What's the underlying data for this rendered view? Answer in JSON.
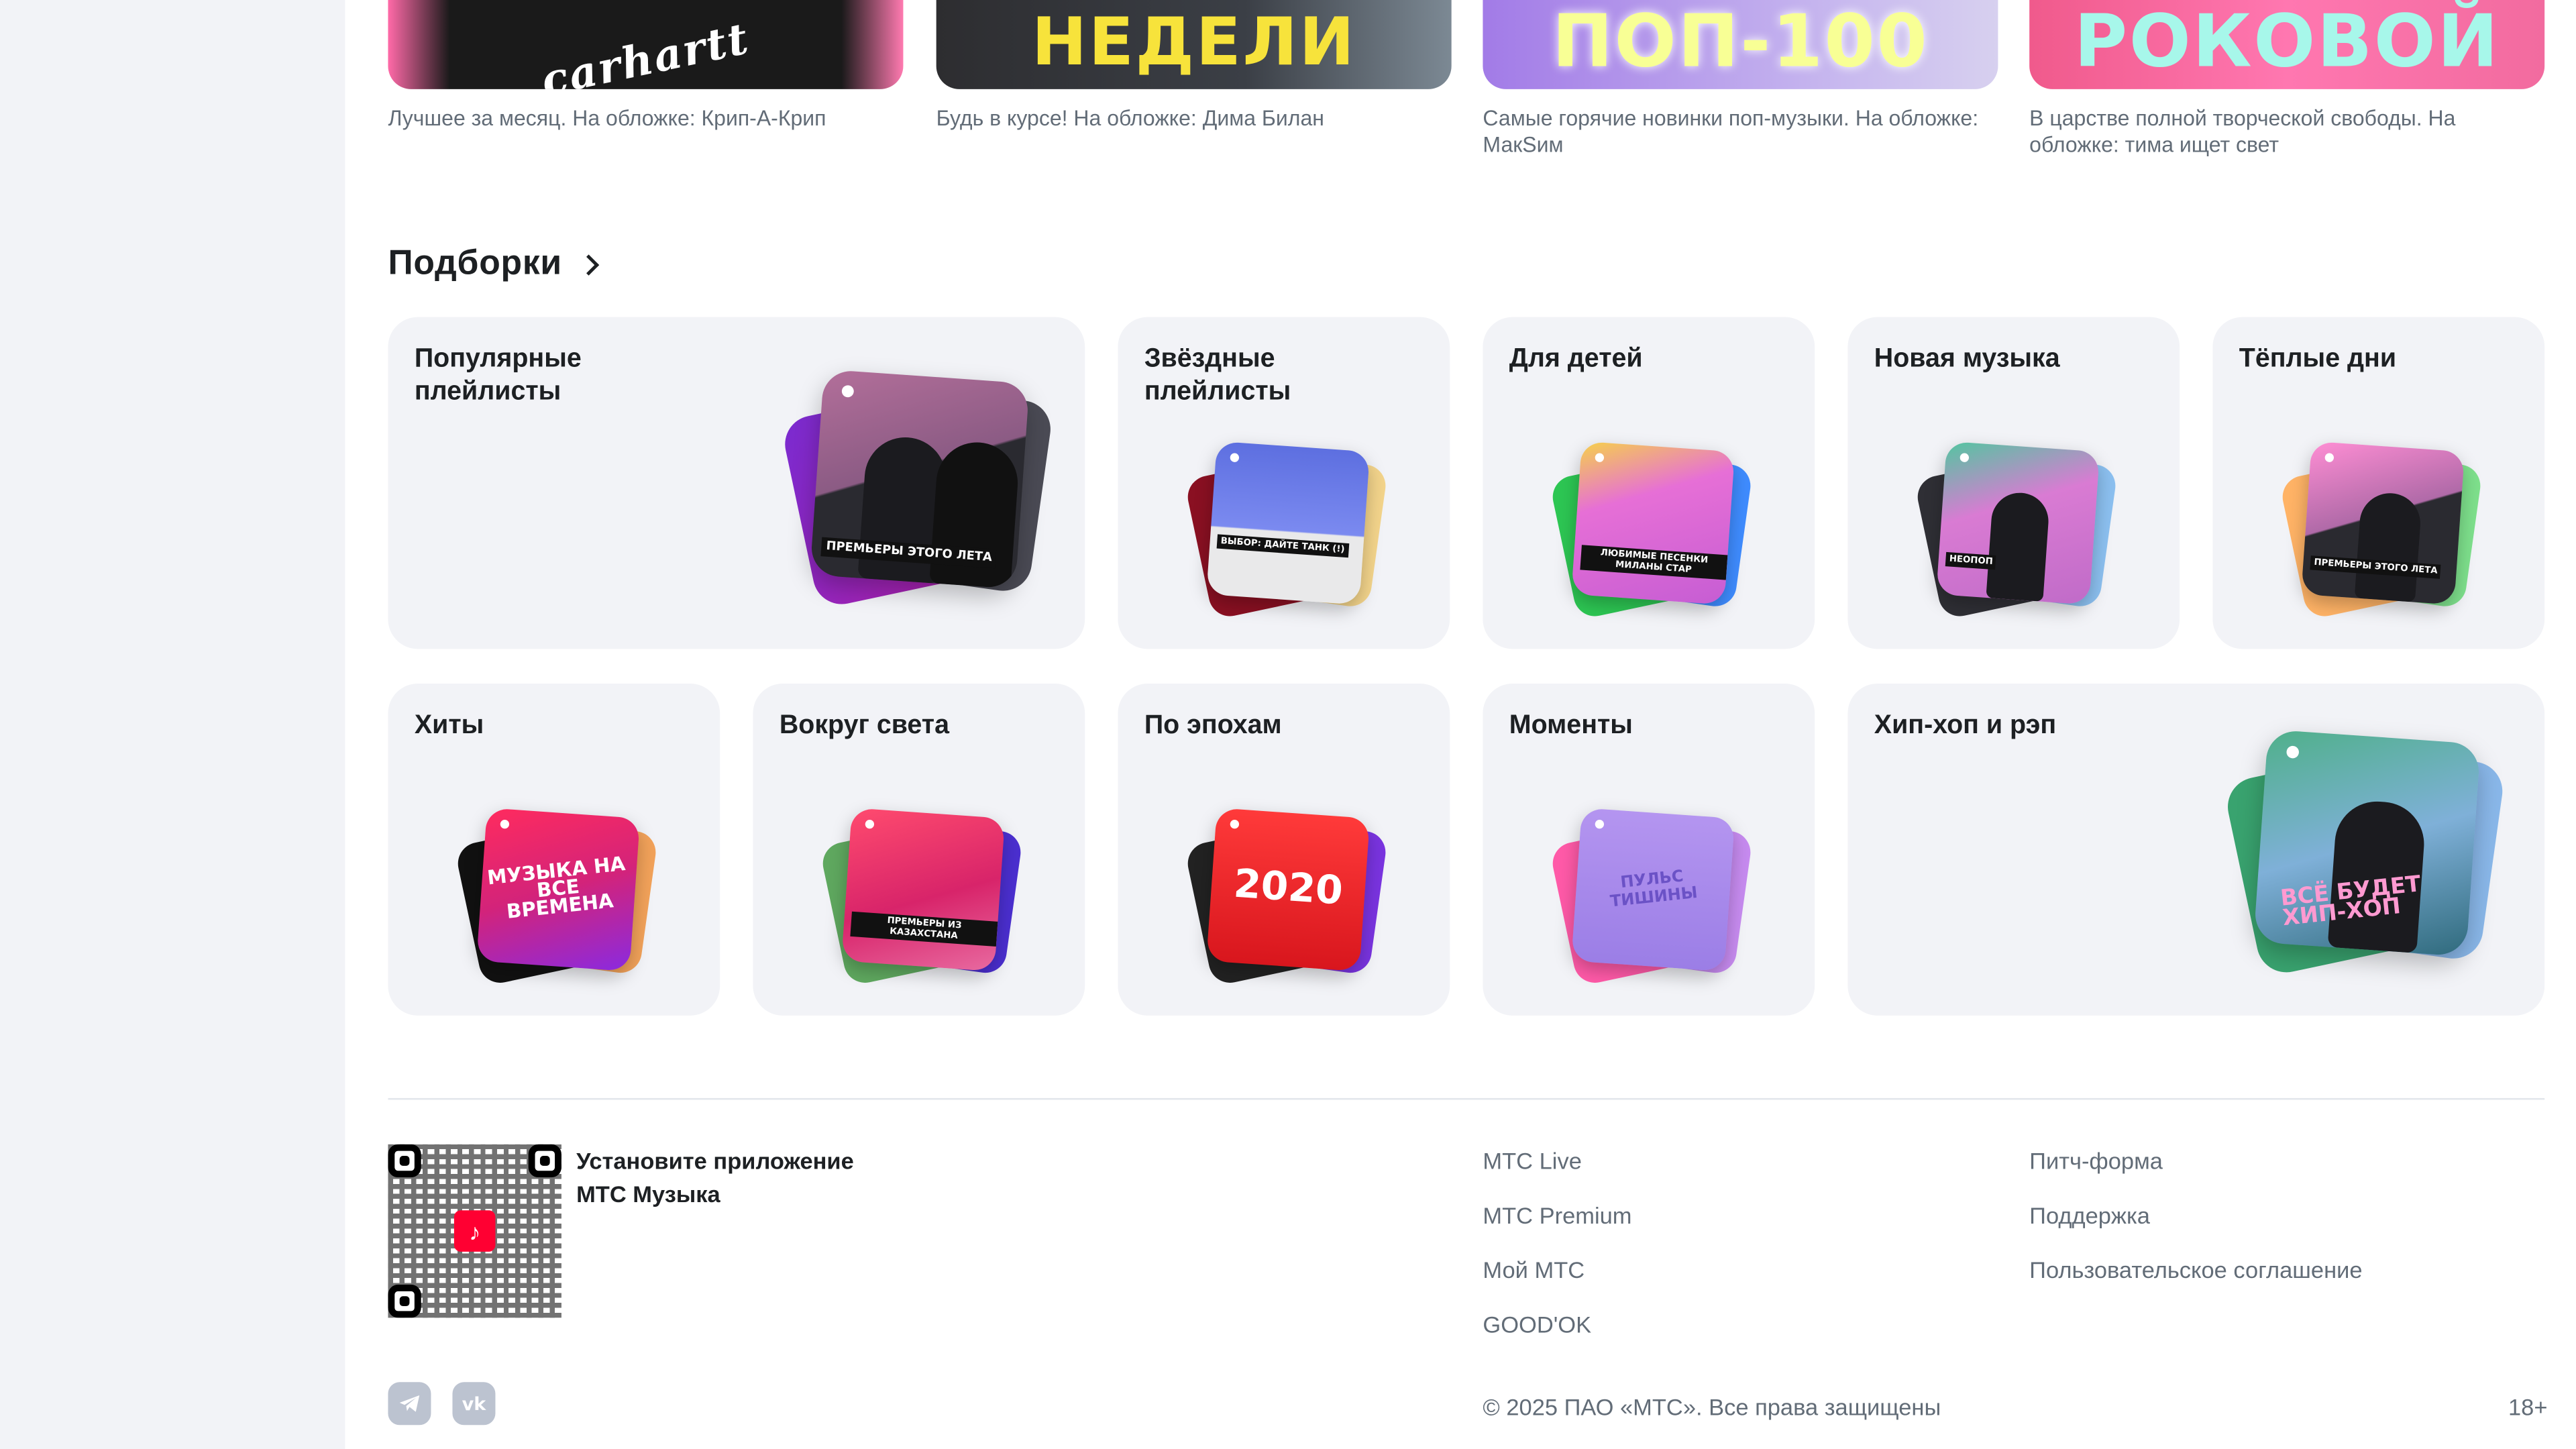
{
  "releases": [
    {
      "cover_text": "carhartt",
      "desc": "Лучшее за месяц. На обложке: Крип-А-Крип"
    },
    {
      "cover_text": "НЕДЕЛИ",
      "desc": "Будь в курсе! На обложке: Дима Билан"
    },
    {
      "cover_text": "ПОП-100",
      "desc": "Самые горячие новинки поп-музыки. На обложке: МакSим"
    },
    {
      "cover_text": "РОКОВОЙ",
      "desc": "В царстве полной творческой свободы. На обложке: тима ищет свет"
    }
  ],
  "collections": {
    "title": "Подборки",
    "cards": [
      {
        "title": "Популярные плейлисты",
        "cover_text": "ПРЕМЬЕРЫ ЭТОГО ЛЕТА"
      },
      {
        "title": "Звёздные плейлисты",
        "cover_text": "ВЫБОР: ДАЙТЕ ТАНК (!)"
      },
      {
        "title": "Для детей",
        "cover_text": "ЛЮБИМЫЕ ПЕСЕНКИ МИЛАНЫ СТАР"
      },
      {
        "title": "Новая музыка",
        "cover_text": "НЕОПОП"
      },
      {
        "title": "Тёплые дни",
        "cover_text": "ПРЕМЬЕРЫ ЭТОГО ЛЕТА"
      },
      {
        "title": "Хиты",
        "cover_text": "МУЗЫКА НА ВСЕ ВРЕМЕНА"
      },
      {
        "title": "Вокруг света",
        "cover_text": "ПРЕМЬЕРЫ ИЗ КАЗАХСТАНА"
      },
      {
        "title": "По эпохам",
        "cover_text": "2020"
      },
      {
        "title": "Моменты",
        "cover_text": "ПУЛЬС ТИШИНЫ"
      },
      {
        "title": "Хип-хоп и рэп",
        "cover_text": "ВСЁ БУДЕТ ХИП-ХОП"
      }
    ]
  },
  "footer": {
    "app_text": "Установите приложение МТС Музыка",
    "links_col1": [
      "МТС Live",
      "МТС Premium",
      "Мой МТС",
      "GOOD'OK"
    ],
    "links_col2": [
      "Питч-форма",
      "Поддержка",
      "Пользовательское соглашение"
    ],
    "copyright": "© 2025 ПАО «МТС». Все права защищены",
    "age": "18+",
    "social": [
      "telegram-icon",
      "vk-icon"
    ]
  },
  "colors": {
    "accent": "#ff0032",
    "card_bg": "#f2f3f7",
    "muted_text": "#626c77"
  }
}
